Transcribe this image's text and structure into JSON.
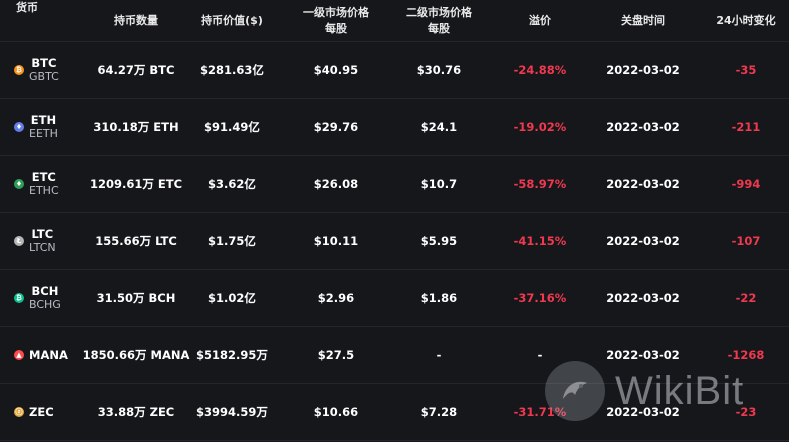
{
  "header": {
    "coin": "货币",
    "holdings": "持币数量",
    "value": "持币价值($)",
    "primary_line1": "一级市场价格",
    "primary_line2": "每股",
    "secondary_line1": "二级市场价格",
    "secondary_line2": "每股",
    "premium": "溢价",
    "close_date": "关盘时间",
    "change_24h": "24小时变化"
  },
  "rows": [
    {
      "symbol": "BTC",
      "fund": "GBTC",
      "icon": "bitcoin-icon",
      "icon_color": "#f7931a",
      "icon_glyph": "₿",
      "holdings": "64.27万 BTC",
      "value": "$281.63亿",
      "primary": "$40.95",
      "secondary": "$30.76",
      "premium": "-24.88%",
      "close": "2022-03-02",
      "change": "-35"
    },
    {
      "symbol": "ETH",
      "fund": "EETH",
      "icon": "ethereum-icon",
      "icon_color": "#627eea",
      "icon_glyph": "♦",
      "holdings": "310.18万 ETH",
      "value": "$91.49亿",
      "primary": "$29.76",
      "secondary": "$24.1",
      "premium": "-19.02%",
      "close": "2022-03-02",
      "change": "-211"
    },
    {
      "symbol": "ETC",
      "fund": "ETHC",
      "icon": "ethereum-classic-icon",
      "icon_color": "#2f9e5a",
      "icon_glyph": "♦",
      "holdings": "1209.61万 ETC",
      "value": "$3.62亿",
      "primary": "$26.08",
      "secondary": "$10.7",
      "premium": "-58.97%",
      "close": "2022-03-02",
      "change": "-994"
    },
    {
      "symbol": "LTC",
      "fund": "LTCN",
      "icon": "litecoin-icon",
      "icon_color": "#b5b5b5",
      "icon_glyph": "Ł",
      "holdings": "155.66万 LTC",
      "value": "$1.75亿",
      "primary": "$10.11",
      "secondary": "$5.95",
      "premium": "-41.15%",
      "close": "2022-03-02",
      "change": "-107"
    },
    {
      "symbol": "BCH",
      "fund": "BCHG",
      "icon": "bitcoin-cash-icon",
      "icon_color": "#0ac18e",
      "icon_glyph": "₿",
      "holdings": "31.50万 BCH",
      "value": "$1.02亿",
      "primary": "$2.96",
      "secondary": "$1.86",
      "premium": "-37.16%",
      "close": "2022-03-02",
      "change": "-22"
    },
    {
      "symbol": "MANA",
      "fund": "",
      "icon": "decentraland-icon",
      "icon_color": "#ff4a4a",
      "icon_glyph": "▲",
      "holdings": "1850.66万 MANA",
      "value": "$5182.95万",
      "primary": "$27.5",
      "secondary": "-",
      "premium": "-",
      "close": "2022-03-02",
      "change": "-1268"
    },
    {
      "symbol": "ZEC",
      "fund": "",
      "icon": "zcash-icon",
      "icon_color": "#e5a93d",
      "icon_glyph": "ⓩ",
      "holdings": "33.88万 ZEC",
      "value": "$3994.59万",
      "primary": "$10.66",
      "secondary": "$7.28",
      "premium": "-31.71%",
      "close": "2022-03-02",
      "change": "-23"
    }
  ],
  "watermark": {
    "text": "WikiBit",
    "icon": "wikibit-logo-icon"
  },
  "colors": {
    "background": "#15171b",
    "negative": "#f0384f",
    "divider": "#23262c"
  }
}
